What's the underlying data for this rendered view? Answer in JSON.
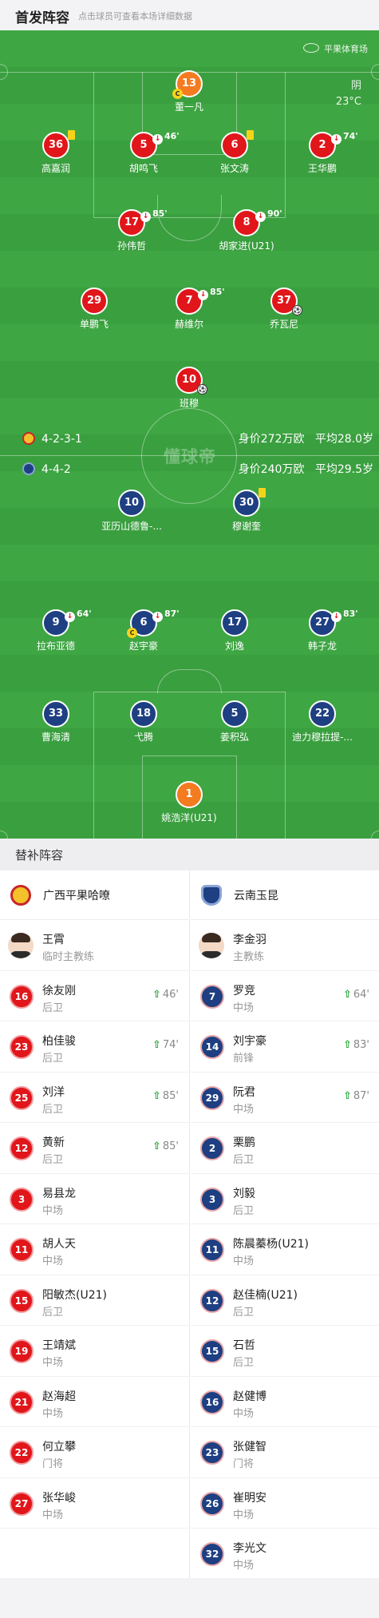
{
  "header": {
    "title": "首发阵容",
    "subtitle": "点击球员可查看本场详细数据"
  },
  "pitch": {
    "stadium": "平果体育场",
    "weather": "阴",
    "temperature": "23°C",
    "watermark": "懂球帝",
    "home_formation": "4-2-3-1",
    "home_value": "身价272万欧",
    "home_age": "平均28.0岁",
    "away_formation": "4-4-2",
    "away_value": "身价240万欧",
    "away_age": "平均29.5岁",
    "home_players": [
      {
        "num": "13",
        "name": "董一凡"
      },
      {
        "num": "36",
        "name": "高嘉润"
      },
      {
        "num": "5",
        "name": "胡鸣飞",
        "sub": "46'"
      },
      {
        "num": "6",
        "name": "张文涛"
      },
      {
        "num": "2",
        "name": "王华鹏",
        "sub": "74'"
      },
      {
        "num": "17",
        "name": "孙伟哲",
        "sub": "85'"
      },
      {
        "num": "8",
        "name": "胡家进(U21)",
        "sub": "90'"
      },
      {
        "num": "29",
        "name": "单鹏飞"
      },
      {
        "num": "7",
        "name": "赫维尔",
        "sub": "85'"
      },
      {
        "num": "37",
        "name": "乔瓦尼"
      },
      {
        "num": "10",
        "name": "班穆"
      }
    ],
    "away_players": [
      {
        "num": "10",
        "name": "亚历山德鲁-..."
      },
      {
        "num": "30",
        "name": "穆谢奎"
      },
      {
        "num": "9",
        "name": "拉布亚德",
        "sub": "64'"
      },
      {
        "num": "6",
        "name": "赵宇豪",
        "sub": "87'"
      },
      {
        "num": "17",
        "name": "刘逸"
      },
      {
        "num": "27",
        "name": "韩子龙",
        "sub": "83'"
      },
      {
        "num": "33",
        "name": "曹海清"
      },
      {
        "num": "18",
        "name": "弋腾"
      },
      {
        "num": "5",
        "name": "姜积弘"
      },
      {
        "num": "22",
        "name": "迪力穆拉提-..."
      },
      {
        "num": "1",
        "name": "姚浩洋(U21)"
      }
    ],
    "captain_mark": "C"
  },
  "subs": {
    "title": "替补阵容",
    "home": {
      "team": "广西平果哈嘹",
      "coach": {
        "name": "王霄",
        "role": "临时主教练"
      },
      "players": [
        {
          "num": "16",
          "name": "徐友刚",
          "pos": "后卫",
          "time": "46'"
        },
        {
          "num": "23",
          "name": "柏佳骏",
          "pos": "后卫",
          "time": "74'"
        },
        {
          "num": "25",
          "name": "刘洋",
          "pos": "后卫",
          "time": "85'"
        },
        {
          "num": "12",
          "name": "黄新",
          "pos": "后卫",
          "time": "85'"
        },
        {
          "num": "3",
          "name": "易县龙",
          "pos": "中场"
        },
        {
          "num": "11",
          "name": "胡人天",
          "pos": "中场"
        },
        {
          "num": "15",
          "name": "阳敏杰(U21)",
          "pos": "后卫"
        },
        {
          "num": "19",
          "name": "王靖斌",
          "pos": "中场"
        },
        {
          "num": "21",
          "name": "赵海超",
          "pos": "中场"
        },
        {
          "num": "22",
          "name": "何立攀",
          "pos": "门将"
        },
        {
          "num": "27",
          "name": "张华峻",
          "pos": "中场"
        }
      ]
    },
    "away": {
      "team": "云南玉昆",
      "coach": {
        "name": "李金羽",
        "role": "主教练"
      },
      "players": [
        {
          "num": "7",
          "name": "罗竞",
          "pos": "中场",
          "time": "64'"
        },
        {
          "num": "14",
          "name": "刘宇豪",
          "pos": "前锋",
          "time": "83'"
        },
        {
          "num": "29",
          "name": "阮君",
          "pos": "中场",
          "time": "87'"
        },
        {
          "num": "2",
          "name": "栗鹏",
          "pos": "后卫"
        },
        {
          "num": "3",
          "name": "刘毅",
          "pos": "后卫"
        },
        {
          "num": "11",
          "name": "陈晨蓁杨(U21)",
          "pos": "中场"
        },
        {
          "num": "12",
          "name": "赵佳楠(U21)",
          "pos": "后卫"
        },
        {
          "num": "15",
          "name": "石哲",
          "pos": "后卫"
        },
        {
          "num": "16",
          "name": "赵健博",
          "pos": "中场"
        },
        {
          "num": "23",
          "name": "张健智",
          "pos": "门将"
        },
        {
          "num": "26",
          "name": "崔明安",
          "pos": "中场"
        },
        {
          "num": "32",
          "name": "李光文",
          "pos": "中场"
        }
      ]
    }
  },
  "colors": {
    "home": "#e0161b",
    "away": "#1e3f82",
    "keeper": "#f47b20",
    "pitch": "#3ea643",
    "sub_in": "#29a33a",
    "card": "#f7d21a"
  },
  "icons": {
    "stadium": "stadium-icon",
    "sub_in": "sub-in-arrow-icon",
    "sub_out": "sub-out-arrow-icon",
    "yellow_card": "yellow-card-icon",
    "captain": "captain-badge-icon",
    "goal": "football-icon"
  }
}
